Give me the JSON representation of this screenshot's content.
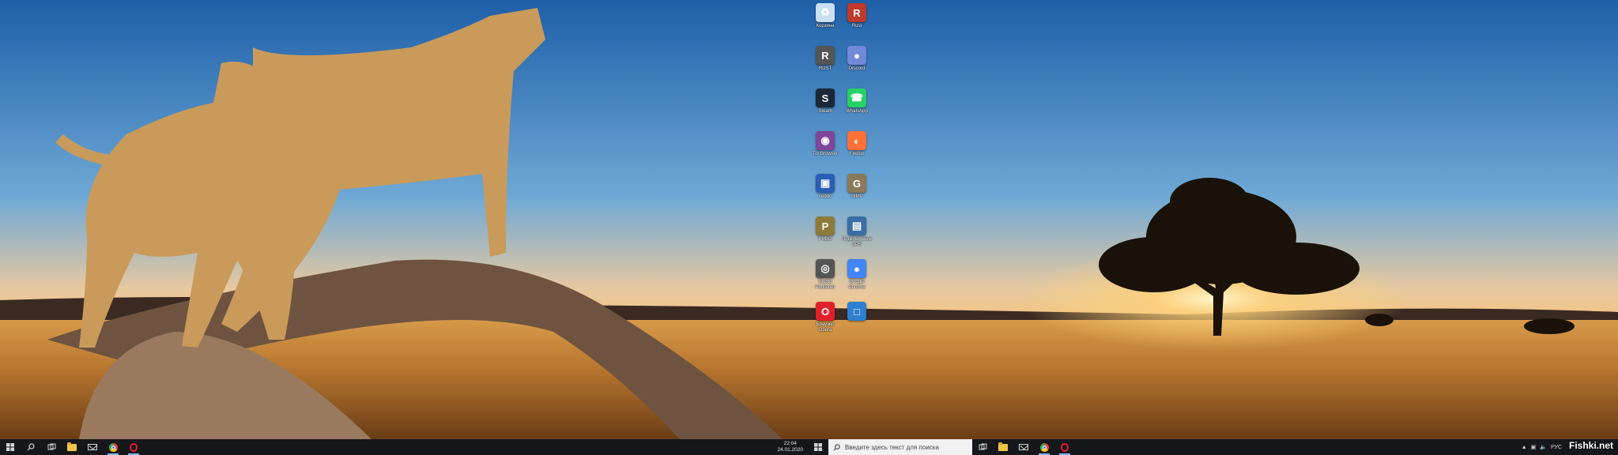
{
  "desktop": {
    "icons": [
      {
        "label": "Корзина",
        "icon": "recycle-bin-icon",
        "color": "#c9dff2"
      },
      {
        "label": "Rust",
        "icon": "rust-icon",
        "color": "#c0392b"
      },
      {
        "label": "RUST",
        "icon": "rust-game-icon",
        "color": "#555555"
      },
      {
        "label": "Discord",
        "icon": "discord-icon",
        "color": "#7289da"
      },
      {
        "label": "Steam",
        "icon": "steam-icon",
        "color": "#1b2838"
      },
      {
        "label": "WhatsApp",
        "icon": "whatsapp-icon",
        "color": "#25d366"
      },
      {
        "label": "Tor Browser",
        "icon": "tor-icon",
        "color": "#7d4698"
      },
      {
        "label": "Firefox",
        "icon": "firefox-icon",
        "color": "#ff7139"
      },
      {
        "label": "cedoc",
        "icon": "app-icon",
        "color": "#2b5fb3"
      },
      {
        "label": "GIMP",
        "icon": "gimp-icon",
        "color": "#8a7a5a"
      },
      {
        "label": "PUBG",
        "icon": "pubg-icon",
        "color": "#8c7b3a"
      },
      {
        "label": "Подключение SPS",
        "icon": "remote-desktop-icon",
        "color": "#3a6ea5"
      },
      {
        "label": "Studio Publisher",
        "icon": "camera-icon",
        "color": "#555555"
      },
      {
        "label": "Google Chrome",
        "icon": "chrome-icon",
        "color": "#4285f4"
      },
      {
        "label": "Браузер Opera",
        "icon": "opera-icon",
        "color": "#e0202a"
      },
      {
        "label": "",
        "icon": "computer-icon",
        "color": "#2f7fd1"
      }
    ]
  },
  "taskbar_left": {
    "start": "windows-start-icon",
    "search": "search-icon",
    "task_view": "task-view-icon",
    "apps": [
      "file-explorer-icon",
      "mail-icon",
      "chrome-icon",
      "opera-icon"
    ],
    "clock_time": "22:04",
    "clock_date": "24.01.2020"
  },
  "taskbar_right": {
    "start": "windows-start-icon",
    "search_placeholder": "Введите здесь текст для поиска",
    "task_view": "task-view-icon",
    "apps": [
      "file-explorer-icon",
      "mail-icon",
      "chrome-icon",
      "opera-icon"
    ],
    "tray_lang": "РУС"
  },
  "watermark": "Fishki.net",
  "colors": {
    "taskbar": "#16171b",
    "sky_top": "#1e5fa8",
    "grass": "#c8873a"
  }
}
